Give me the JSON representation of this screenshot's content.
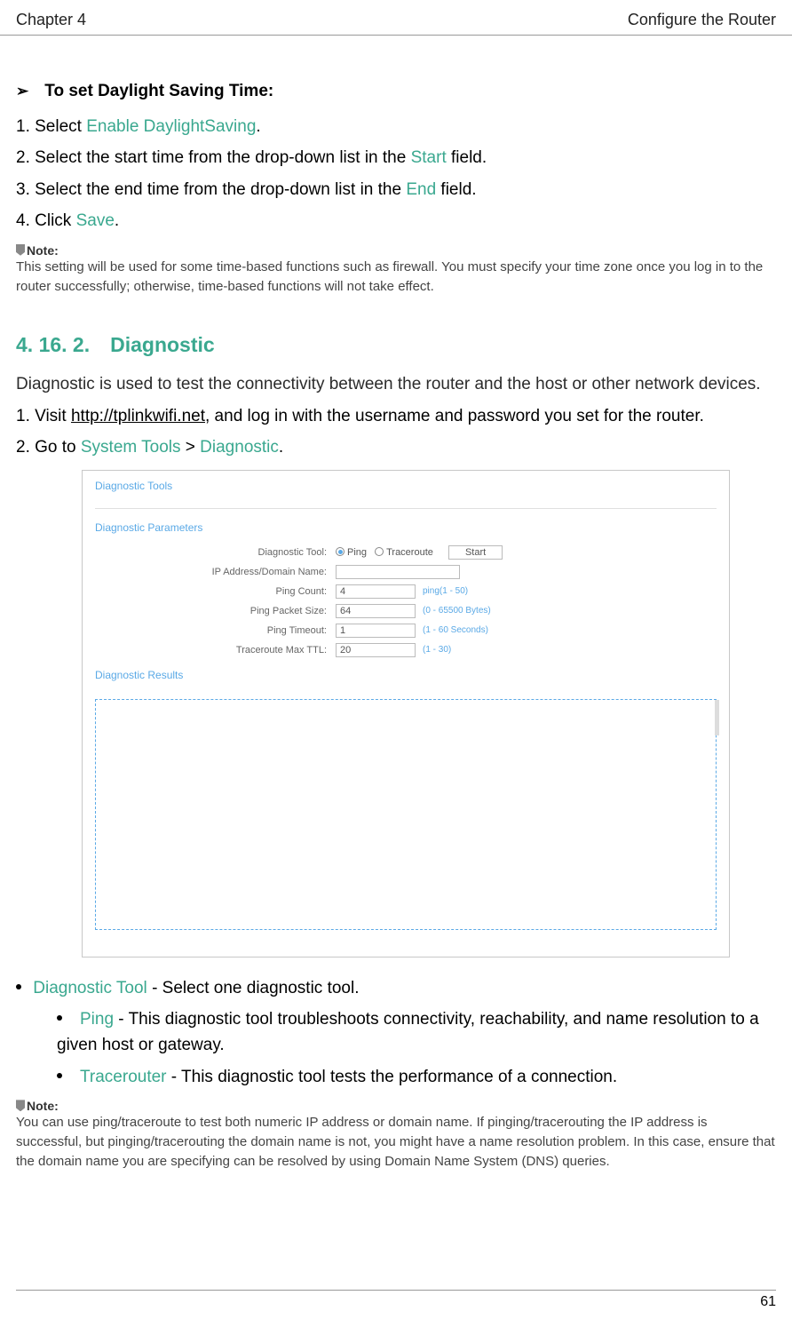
{
  "header": {
    "chapter": "Chapter 4",
    "title": "Configure the Router"
  },
  "section1": {
    "heading": "To set Daylight Saving Time:",
    "step1_a": "1. Select ",
    "step1_b": "Enable DaylightSaving",
    "step1_c": ".",
    "step2_a": "2. Select the start time from the drop-down list in the ",
    "step2_b": "Start",
    "step2_c": " field.",
    "step3_a": "3. Select the end time from the drop-down list in the ",
    "step3_b": "End",
    "step3_c": " field.",
    "step4_a": "4. Click ",
    "step4_b": "Save",
    "step4_c": ".",
    "note_label": "Note:",
    "note_text": "This setting will be used for some time-based functions such as firewall. You must specify your time zone once you log in to the router successfully; otherwise, time-based functions will not take effect."
  },
  "section2": {
    "heading": "4. 16. 2. Diagnostic",
    "intro": "Diagnostic is used to test the connectivity between the router and the host or other network devices.",
    "step1_a": "1. Visit ",
    "step1_link": "http://tplinkwifi.net",
    "step1_b": ", and log in with the username and password you set for the router.",
    "step2_a": "2. Go to ",
    "step2_b": "System Tools",
    "step2_c": " > ",
    "step2_d": "Diagnostic",
    "step2_e": "."
  },
  "screenshot": {
    "title": "Diagnostic Tools",
    "params_label": "Diagnostic Parameters",
    "tool_label": "Diagnostic Tool:",
    "radio_ping": "Ping",
    "radio_trace": "Traceroute",
    "start_btn": "Start",
    "ip_label": "IP Address/Domain Name:",
    "ping_count_label": "Ping Count:",
    "ping_count_val": "4",
    "ping_count_hint": "ping(1 - 50)",
    "packet_label": "Ping Packet Size:",
    "packet_val": "64",
    "packet_hint": "(0 - 65500 Bytes)",
    "timeout_label": "Ping Timeout:",
    "timeout_val": "1",
    "timeout_hint": "(1 - 60 Seconds)",
    "ttl_label": "Traceroute Max TTL:",
    "ttl_val": "20",
    "ttl_hint": "(1 - 30)",
    "results_label": "Diagnostic Results"
  },
  "bullets": {
    "b1_a": "Diagnostic Tool",
    "b1_b": " - Select one diagnostic tool.",
    "b2_a": "Ping",
    "b2_b": " - This diagnostic tool troubleshoots connectivity, reachability, and name resolution to a given host or gateway.",
    "b3_a": "Tracerouter",
    "b3_b": " - This diagnostic tool tests the performance of a connection.",
    "note_label": "Note:",
    "note_text": "You can use ping/traceroute to test both numeric IP address or domain name. If pinging/tracerouting the IP address is successful, but pinging/tracerouting the domain name is not, you might have a name resolution problem. In this case, ensure that the domain name you are specifying can be resolved by using Domain Name System (DNS) queries."
  },
  "footer": {
    "page": "61"
  }
}
